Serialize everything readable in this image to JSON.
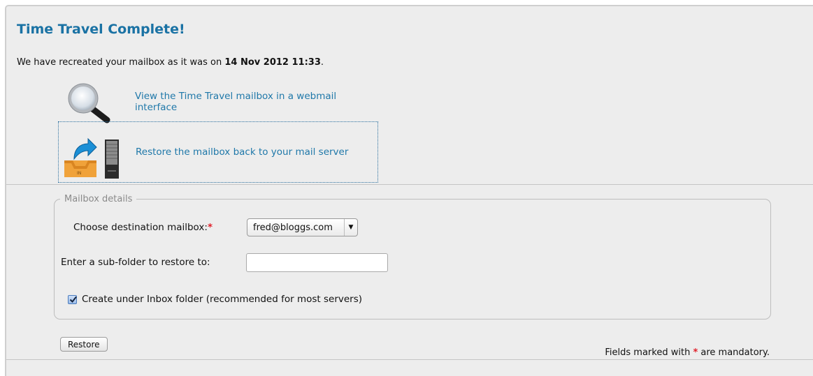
{
  "page": {
    "title": "Time Travel Complete!",
    "intro_prefix": "We have recreated your mailbox as it was on ",
    "intro_date": "14 Nov 2012 11:33",
    "intro_suffix": "."
  },
  "actions": [
    {
      "label": "View the Time Travel mailbox in a webmail interface",
      "icon": "magnifier-icon"
    },
    {
      "label": "Restore the mailbox back to your mail server",
      "icon": "restore-to-server-icon"
    }
  ],
  "form": {
    "legend": "Mailbox details",
    "destination_label": "Choose destination mailbox:",
    "required_marker": "*",
    "destination_value": "fred@bloggs.com",
    "subfolder_label": "Enter a sub-folder to restore to:",
    "subfolder_value": "",
    "inbox_checkbox_label": "Create under Inbox folder (recommended for most servers)",
    "inbox_checked": true,
    "restore_button": "Restore",
    "mandatory_prefix": "Fields marked with ",
    "mandatory_star": "*",
    "mandatory_suffix": " are mandatory."
  },
  "colors": {
    "title": "#1a72a4",
    "link": "#1f78a9",
    "required": "#e0202a",
    "panel_bg": "#ededed"
  }
}
